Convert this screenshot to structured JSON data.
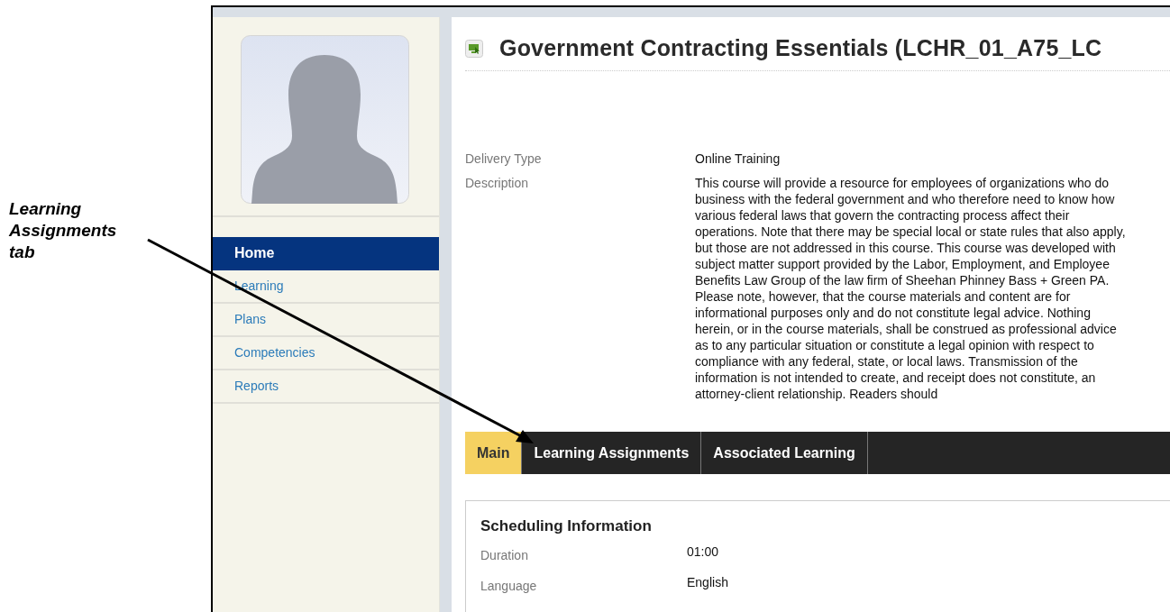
{
  "callout": {
    "label": "Learning Assignments tab"
  },
  "sidebar": {
    "items": [
      {
        "label": "Home",
        "selected": true
      },
      {
        "label": "Learning",
        "selected": false
      },
      {
        "label": "Plans",
        "selected": false
      },
      {
        "label": "Competencies",
        "selected": false
      },
      {
        "label": "Reports",
        "selected": false
      }
    ]
  },
  "course": {
    "title": "Government Contracting Essentials (LCHR_01_A75_LC",
    "fields": [
      {
        "label": "Delivery Type",
        "value": "Online Training"
      },
      {
        "label": "Description",
        "value": "This course will provide a resource for employees of organizations who do business with the federal government and who therefore need to know how various federal laws that govern the contracting process affect their operations. Note that there may be special local or state rules that also apply, but those are not addressed in this course. This course was developed with subject matter support provided by the Labor, Employment, and Employee Benefits Law Group of the law firm of Sheehan Phinney Bass + Green PA. Please note, however, that the course materials and content are for informational purposes only and do not constitute legal advice. Nothing herein, or in the course materials, shall be construed as professional advice as to any particular situation or constitute a legal opinion with respect to compliance with any federal, state, or local laws. Transmission of the information is not intended to create, and receipt does not constitute, an attorney-client relationship. Readers should"
      }
    ]
  },
  "tabs": [
    {
      "label": "Main",
      "selected": true
    },
    {
      "label": "Learning Assignments",
      "selected": false
    },
    {
      "label": "Associated Learning",
      "selected": false
    }
  ],
  "section": {
    "title": "Scheduling Information",
    "fields": [
      {
        "label": "Duration",
        "value": "01:00"
      },
      {
        "label": "Language",
        "value": "English"
      }
    ]
  }
}
